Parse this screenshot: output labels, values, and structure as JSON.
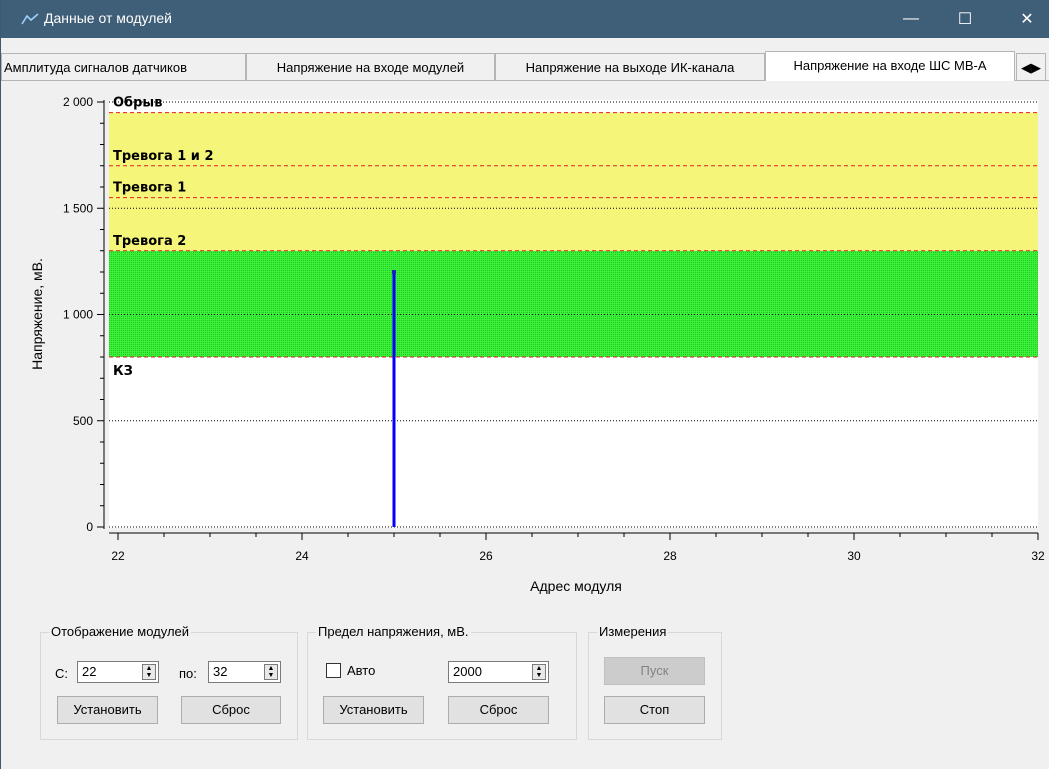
{
  "window": {
    "title": "Данные от модулей",
    "minimize": "—",
    "maximize": "☐",
    "close": "✕"
  },
  "tabs": [
    {
      "label": "Амплитуда сигналов датчиков",
      "active": false
    },
    {
      "label": "Напряжение на входе модулей",
      "active": false
    },
    {
      "label": "Напряжение на выходе ИК-канала",
      "active": false
    },
    {
      "label": "Напряжение на входе ШС МВ-А",
      "active": true
    }
  ],
  "tab_scroll_label": "◀▶",
  "chart_data": {
    "type": "bar",
    "xlabel": "Адрес модуля",
    "ylabel": "Напряжение, мВ.",
    "xlim": [
      22,
      32
    ],
    "ylim": [
      0,
      2000
    ],
    "x_ticks": [
      "22",
      "24",
      "26",
      "28",
      "30",
      "32"
    ],
    "y_ticks": [
      "0",
      "500",
      "1 000",
      "1 500",
      "2 000"
    ],
    "bars": [
      {
        "x": 25,
        "y": 1200
      }
    ],
    "bar_color": "#0000ff",
    "bands": [
      {
        "from": 800,
        "to": 1300,
        "color": "#22e022"
      },
      {
        "from": 1300,
        "to": 1950,
        "color": "#f5f57a"
      }
    ],
    "thresholds": [
      {
        "value": 1950,
        "label": "Обрыв"
      },
      {
        "value": 1700,
        "label": "Тревога 1 и 2"
      },
      {
        "value": 1550,
        "label": "Тревога 1"
      },
      {
        "value": 1300,
        "label": "Тревога 2"
      },
      {
        "value": 800,
        "label": "КЗ"
      }
    ],
    "gridlines": [
      0,
      500,
      1000,
      1500,
      2000
    ],
    "grid": true
  },
  "controls": {
    "modules_group": {
      "title": "Отображение модулей",
      "from_label": "С:",
      "from_value": "22",
      "to_label": "по:",
      "to_value": "32",
      "set_button": "Установить",
      "reset_button": "Сброс"
    },
    "limit_group": {
      "title": "Предел напряжения, мВ.",
      "auto_label": "Авто",
      "auto_checked": false,
      "limit_value": "2000",
      "set_button": "Установить",
      "reset_button": "Сброс"
    },
    "measure_group": {
      "title": "Измерения",
      "start_button": "Пуск",
      "stop_button": "Стоп"
    }
  }
}
